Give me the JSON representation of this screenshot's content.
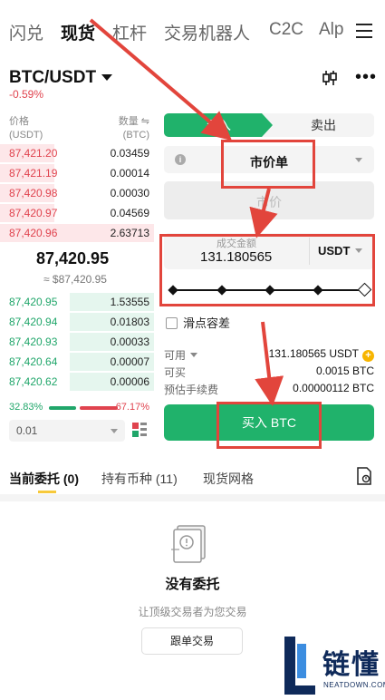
{
  "top_nav": {
    "tabs": [
      "闪兑",
      "现货",
      "杠杆",
      "交易机器人",
      "C2C",
      "Alp"
    ],
    "active_index": 1
  },
  "pair": {
    "symbol": "BTC/USDT",
    "change": "-0.59%"
  },
  "orderbook": {
    "price_header": "价格",
    "price_unit": "(USDT)",
    "qty_header": "数量 ⇋",
    "qty_unit": "(BTC)",
    "asks": [
      {
        "price": "87,421.20",
        "qty": "0.03459",
        "depth": 0.15
      },
      {
        "price": "87,421.19",
        "qty": "0.00014",
        "depth": 0.05
      },
      {
        "price": "87,420.98",
        "qty": "0.00030",
        "depth": 0.05
      },
      {
        "price": "87,420.97",
        "qty": "0.04569",
        "depth": 0.2
      },
      {
        "price": "87,420.96",
        "qty": "2.63713",
        "depth": 1.0
      }
    ],
    "last_price": "87,420.95",
    "last_price_usd": "≈ $87,420.95",
    "bids": [
      {
        "price": "87,420.95",
        "qty": "1.53555",
        "depth": 0.55
      },
      {
        "price": "87,420.94",
        "qty": "0.01803",
        "depth": 0.55
      },
      {
        "price": "87,420.93",
        "qty": "0.00033",
        "depth": 0.55
      },
      {
        "price": "87,420.64",
        "qty": "0.00007",
        "depth": 0.55
      },
      {
        "price": "87,420.62",
        "qty": "0.00006",
        "depth": 0.55
      }
    ],
    "buy_ratio": "32.83%",
    "sell_ratio": "67.17%",
    "precision": "0.01"
  },
  "order_form": {
    "buy_label": "买入",
    "sell_label": "卖出",
    "order_type": "市价单",
    "price_placeholder": "市价",
    "amount_caption": "成交金额",
    "amount_value": "131.180565",
    "amount_unit": "USDT",
    "slip_label": "滑点容差",
    "available_label": "可用",
    "available_value": "131.180565 USDT",
    "can_buy_label": "可买",
    "can_buy_value": "0.0015 BTC",
    "fee_label": "预估手续费",
    "fee_value": "0.00000112 BTC",
    "submit_label": "买入 BTC"
  },
  "bottom_tabs": {
    "tabs": [
      "当前委托 (0)",
      "持有币种 (11)",
      "现货网格"
    ],
    "active_index": 0
  },
  "empty_state": {
    "title": "没有委托",
    "subtitle": "让顶级交易者为您交易",
    "button": "跟单交易"
  },
  "watermark": {
    "text": "链懂",
    "url": "NEATDOWN.COM"
  },
  "colors": {
    "buy_green": "#20b26b",
    "sell_red": "#e0434e",
    "annotation_red": "#e2453c"
  }
}
